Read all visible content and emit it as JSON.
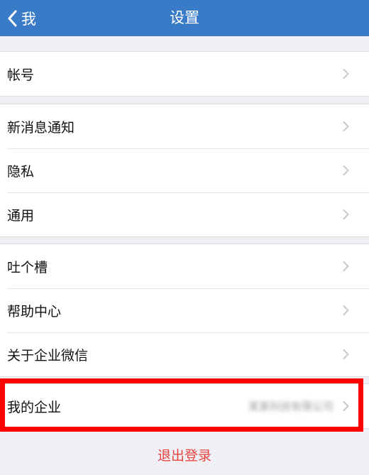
{
  "nav": {
    "back_label": "我",
    "title": "设置"
  },
  "groups": [
    {
      "items": [
        {
          "label": "帐号"
        }
      ]
    },
    {
      "items": [
        {
          "label": "新消息通知"
        },
        {
          "label": "隐私"
        },
        {
          "label": "通用"
        }
      ]
    },
    {
      "items": [
        {
          "label": "吐个槽"
        },
        {
          "label": "帮助中心"
        },
        {
          "label": "关于企业微信"
        }
      ]
    },
    {
      "items": [
        {
          "label": "我的企业",
          "value": "某某科技有限公司"
        }
      ]
    }
  ],
  "logout_label": "退出登录",
  "colors": {
    "nav_background": "#3a7bc8",
    "page_background": "#efeff4",
    "logout_text": "#e64340",
    "highlight": "#ff0000"
  }
}
